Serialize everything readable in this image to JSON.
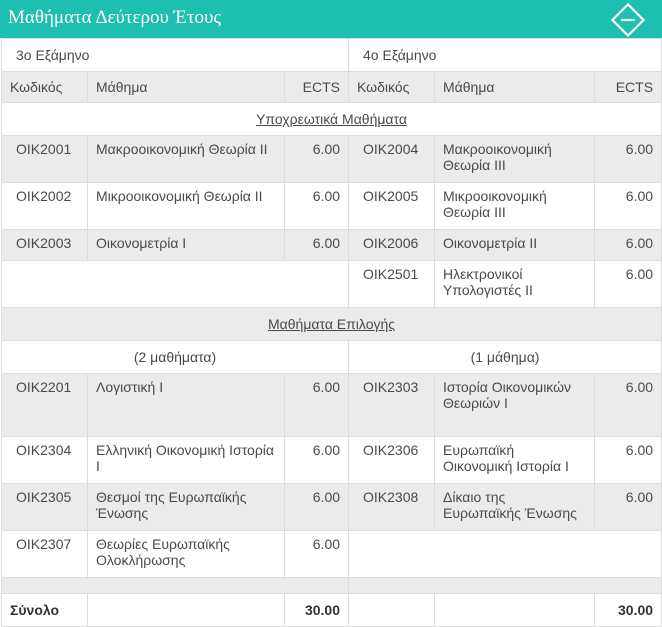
{
  "header": {
    "title": "Μαθήματα Δεύτερου Έτους",
    "toggle_icon": "collapse-minus-diamond-icon",
    "accent": "#1dbfb0"
  },
  "semesters": {
    "left": "3ο Εξάμηνο",
    "right": "4ο Εξάμηνο"
  },
  "columns": {
    "code": "Κωδικός",
    "course": "Μάθημα",
    "ects": "ECTS"
  },
  "compulsory": {
    "title": "Υποχρεωτικά Μαθήματα",
    "left": [
      {
        "code": "ΟΙΚ2001",
        "name": "Μακροοικονομική Θεωρία ΙΙ",
        "ects": "6.00"
      },
      {
        "code": "ΟΙΚ2002",
        "name": "Μικροοικονομική Θεωρία ΙΙ",
        "ects": "6.00"
      },
      {
        "code": "ΟΙΚ2003",
        "name": "Οικονομετρία Ι",
        "ects": "6.00"
      }
    ],
    "right": [
      {
        "code": "ΟΙΚ2004",
        "name": "Μακροοικονομική Θεωρία ΙΙΙ",
        "ects": "6.00"
      },
      {
        "code": "ΟΙΚ2005",
        "name": "Μικροοικονομική Θεωρία ΙΙΙ",
        "ects": "6.00"
      },
      {
        "code": "ΟΙΚ2006",
        "name": "Οικονομετρία ΙΙ",
        "ects": "6.00"
      },
      {
        "code": "ΟΙΚ2501",
        "name": "Ηλεκτρονικοί Υπολογιστές ΙΙ",
        "ects": "6.00"
      }
    ]
  },
  "electives": {
    "title": "Μαθήματα Επιλογής",
    "left_count": "(2 μαθήματα)",
    "right_count": "(1 μάθημα)",
    "left": [
      {
        "code": "ΟΙΚ2201",
        "name": "Λογιστική Ι",
        "ects": "6.00"
      },
      {
        "code": "ΟΙΚ2304",
        "name": "Ελληνική Οικονομική Ιστορία Ι",
        "ects": "6.00"
      },
      {
        "code": "ΟΙΚ2305",
        "name": "Θεσμοί της Ευρωπαϊκής Ένωσης",
        "ects": "6.00"
      },
      {
        "code": "ΟΙΚ2307",
        "name": "Θεωρίες Ευρωπαϊκής Ολοκλήρωσης",
        "ects": "6.00"
      }
    ],
    "right": [
      {
        "code": "ΟΙΚ2303",
        "name": "Ιστορία Οικονομικών Θεωριών Ι",
        "ects": "6.00"
      },
      {
        "code": "ΟΙΚ2306",
        "name": "Ευρωπαϊκή Οικονομική Ιστορία Ι",
        "ects": "6.00"
      },
      {
        "code": "ΟΙΚ2308",
        "name": "Δίκαιο της Ευρωπαϊκής Ένωσης",
        "ects": "6.00"
      }
    ]
  },
  "total": {
    "label": "Σύνολο",
    "left": "30.00",
    "right": "30.00"
  }
}
